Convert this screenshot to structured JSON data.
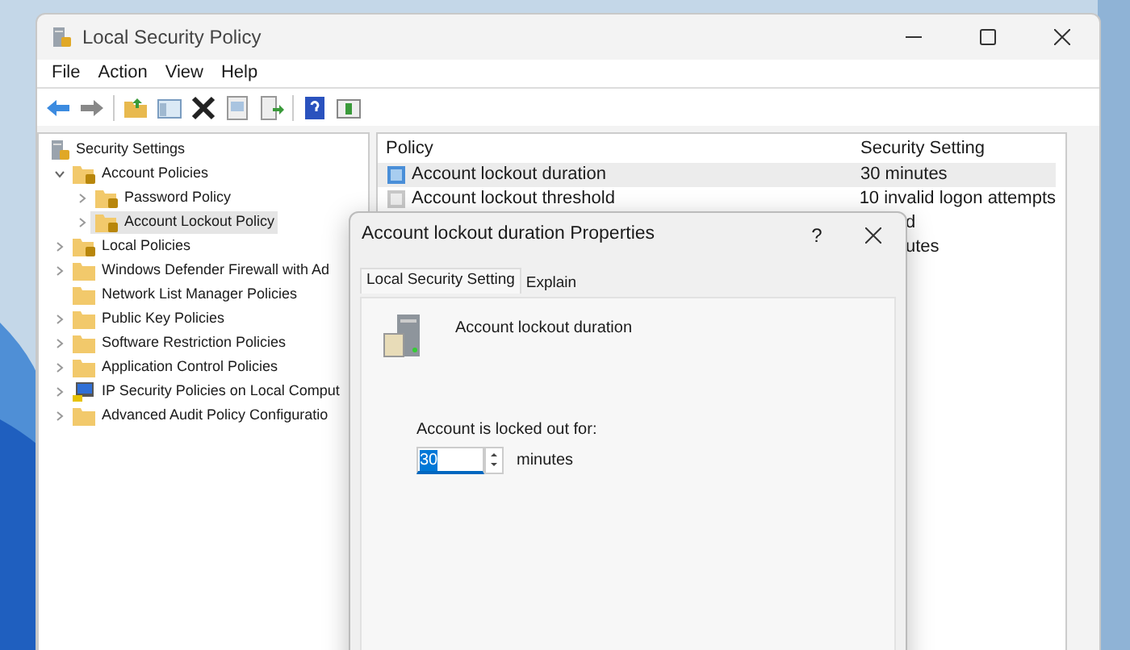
{
  "window": {
    "title": "Local Security Policy"
  },
  "menu": [
    "File",
    "Action",
    "View",
    "Help"
  ],
  "tree": [
    {
      "label": "Security Settings",
      "kind": "server",
      "selected": false,
      "children": [
        {
          "label": "Account Policies",
          "kind": "locked-folder",
          "expanded": true,
          "selected": false,
          "children": [
            {
              "label": "Password Policy",
              "kind": "locked-folder",
              "expanded": false,
              "selected": false
            },
            {
              "label": "Account Lockout Policy",
              "kind": "locked-folder",
              "expanded": false,
              "selected": true
            }
          ]
        },
        {
          "label": "Local Policies",
          "kind": "locked-folder",
          "expanded": false,
          "selected": false
        },
        {
          "label": "Windows Defender Firewall with Ad",
          "kind": "folder",
          "expanded": false,
          "selected": false
        },
        {
          "label": "Network List Manager Policies",
          "kind": "folder",
          "selected": false
        },
        {
          "label": "Public Key Policies",
          "kind": "folder",
          "expanded": false,
          "selected": false
        },
        {
          "label": "Software Restriction Policies",
          "kind": "folder",
          "expanded": false,
          "selected": false
        },
        {
          "label": "Application Control Policies",
          "kind": "folder",
          "expanded": false,
          "selected": false
        },
        {
          "label": "IP Security Policies on Local Comput",
          "kind": "computer",
          "expanded": false,
          "selected": false
        },
        {
          "label": "Advanced Audit Policy Configuratio",
          "kind": "folder",
          "expanded": false,
          "selected": false
        }
      ]
    }
  ],
  "list": {
    "columns": [
      "Policy",
      "Security Setting"
    ],
    "rows": [
      {
        "policy": "Account lockout duration",
        "setting": "30 minutes",
        "kind": "configured",
        "selected": true
      },
      {
        "policy": "Account lockout threshold",
        "setting": "10 invalid logon attempts",
        "kind": "default",
        "selected": false
      },
      {
        "setting": "d",
        "covered": true,
        "selected": false
      },
      {
        "setting": "utes",
        "covered": true,
        "selected": false
      }
    ]
  },
  "dialog": {
    "title": "Account lockout duration Properties",
    "help_label": "?",
    "tabs": [
      {
        "label": "Local Security Setting",
        "selected": true
      },
      {
        "label": "Explain",
        "selected": false
      }
    ],
    "policy_name": "Account lockout duration",
    "field_label": "Account is locked out for:",
    "value": "30",
    "unit": "minutes"
  }
}
